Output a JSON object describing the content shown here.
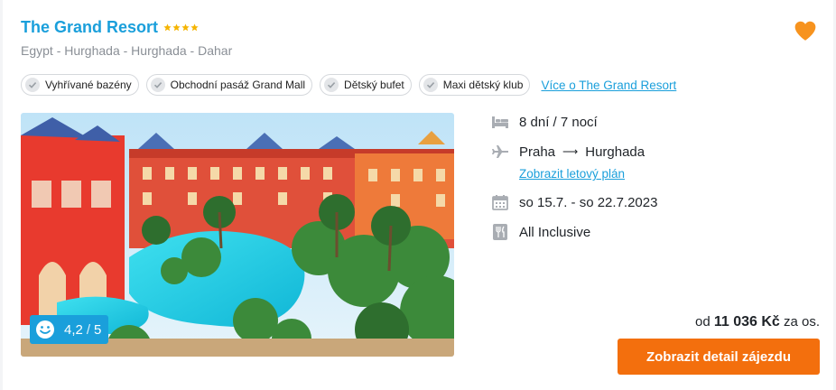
{
  "hotel": {
    "name": "The Grand Resort",
    "stars": 4,
    "location": "Egypt - Hurghada - Hurghada - Dahar"
  },
  "tags": [
    {
      "label": "Vyhřívané bazény"
    },
    {
      "label": "Obchodní pasáž Grand Mall"
    },
    {
      "label": "Dětský bufet"
    },
    {
      "label": "Maxi dětský klub"
    }
  ],
  "more_link": "Více o The Grand Resort",
  "rating": {
    "score": "4,2",
    "separator": "/",
    "max": "5"
  },
  "details": {
    "duration": "8 dní / 7 nocí",
    "from": "Praha",
    "arrow": "⟶",
    "to": "Hurghada",
    "flight_plan_link": "Zobrazit letový plán",
    "dates": "so 15.7. - so 22.7.2023",
    "board": "All Inclusive"
  },
  "price": {
    "prefix": "od",
    "amount": "11 036 Kč",
    "suffix": "za os."
  },
  "cta_label": "Zobrazit detail zájezdu",
  "colors": {
    "accent": "#1a9fdb",
    "cta": "#f36f0d",
    "heart": "#f7931e",
    "stars": "#f5b400"
  },
  "icons": {
    "favorite": "heart-icon",
    "tag": "check-icon",
    "duration": "bed-icon",
    "flight": "airplane-icon",
    "dates": "calendar-icon",
    "board": "cutlery-icon",
    "rating": "smiley-icon"
  }
}
